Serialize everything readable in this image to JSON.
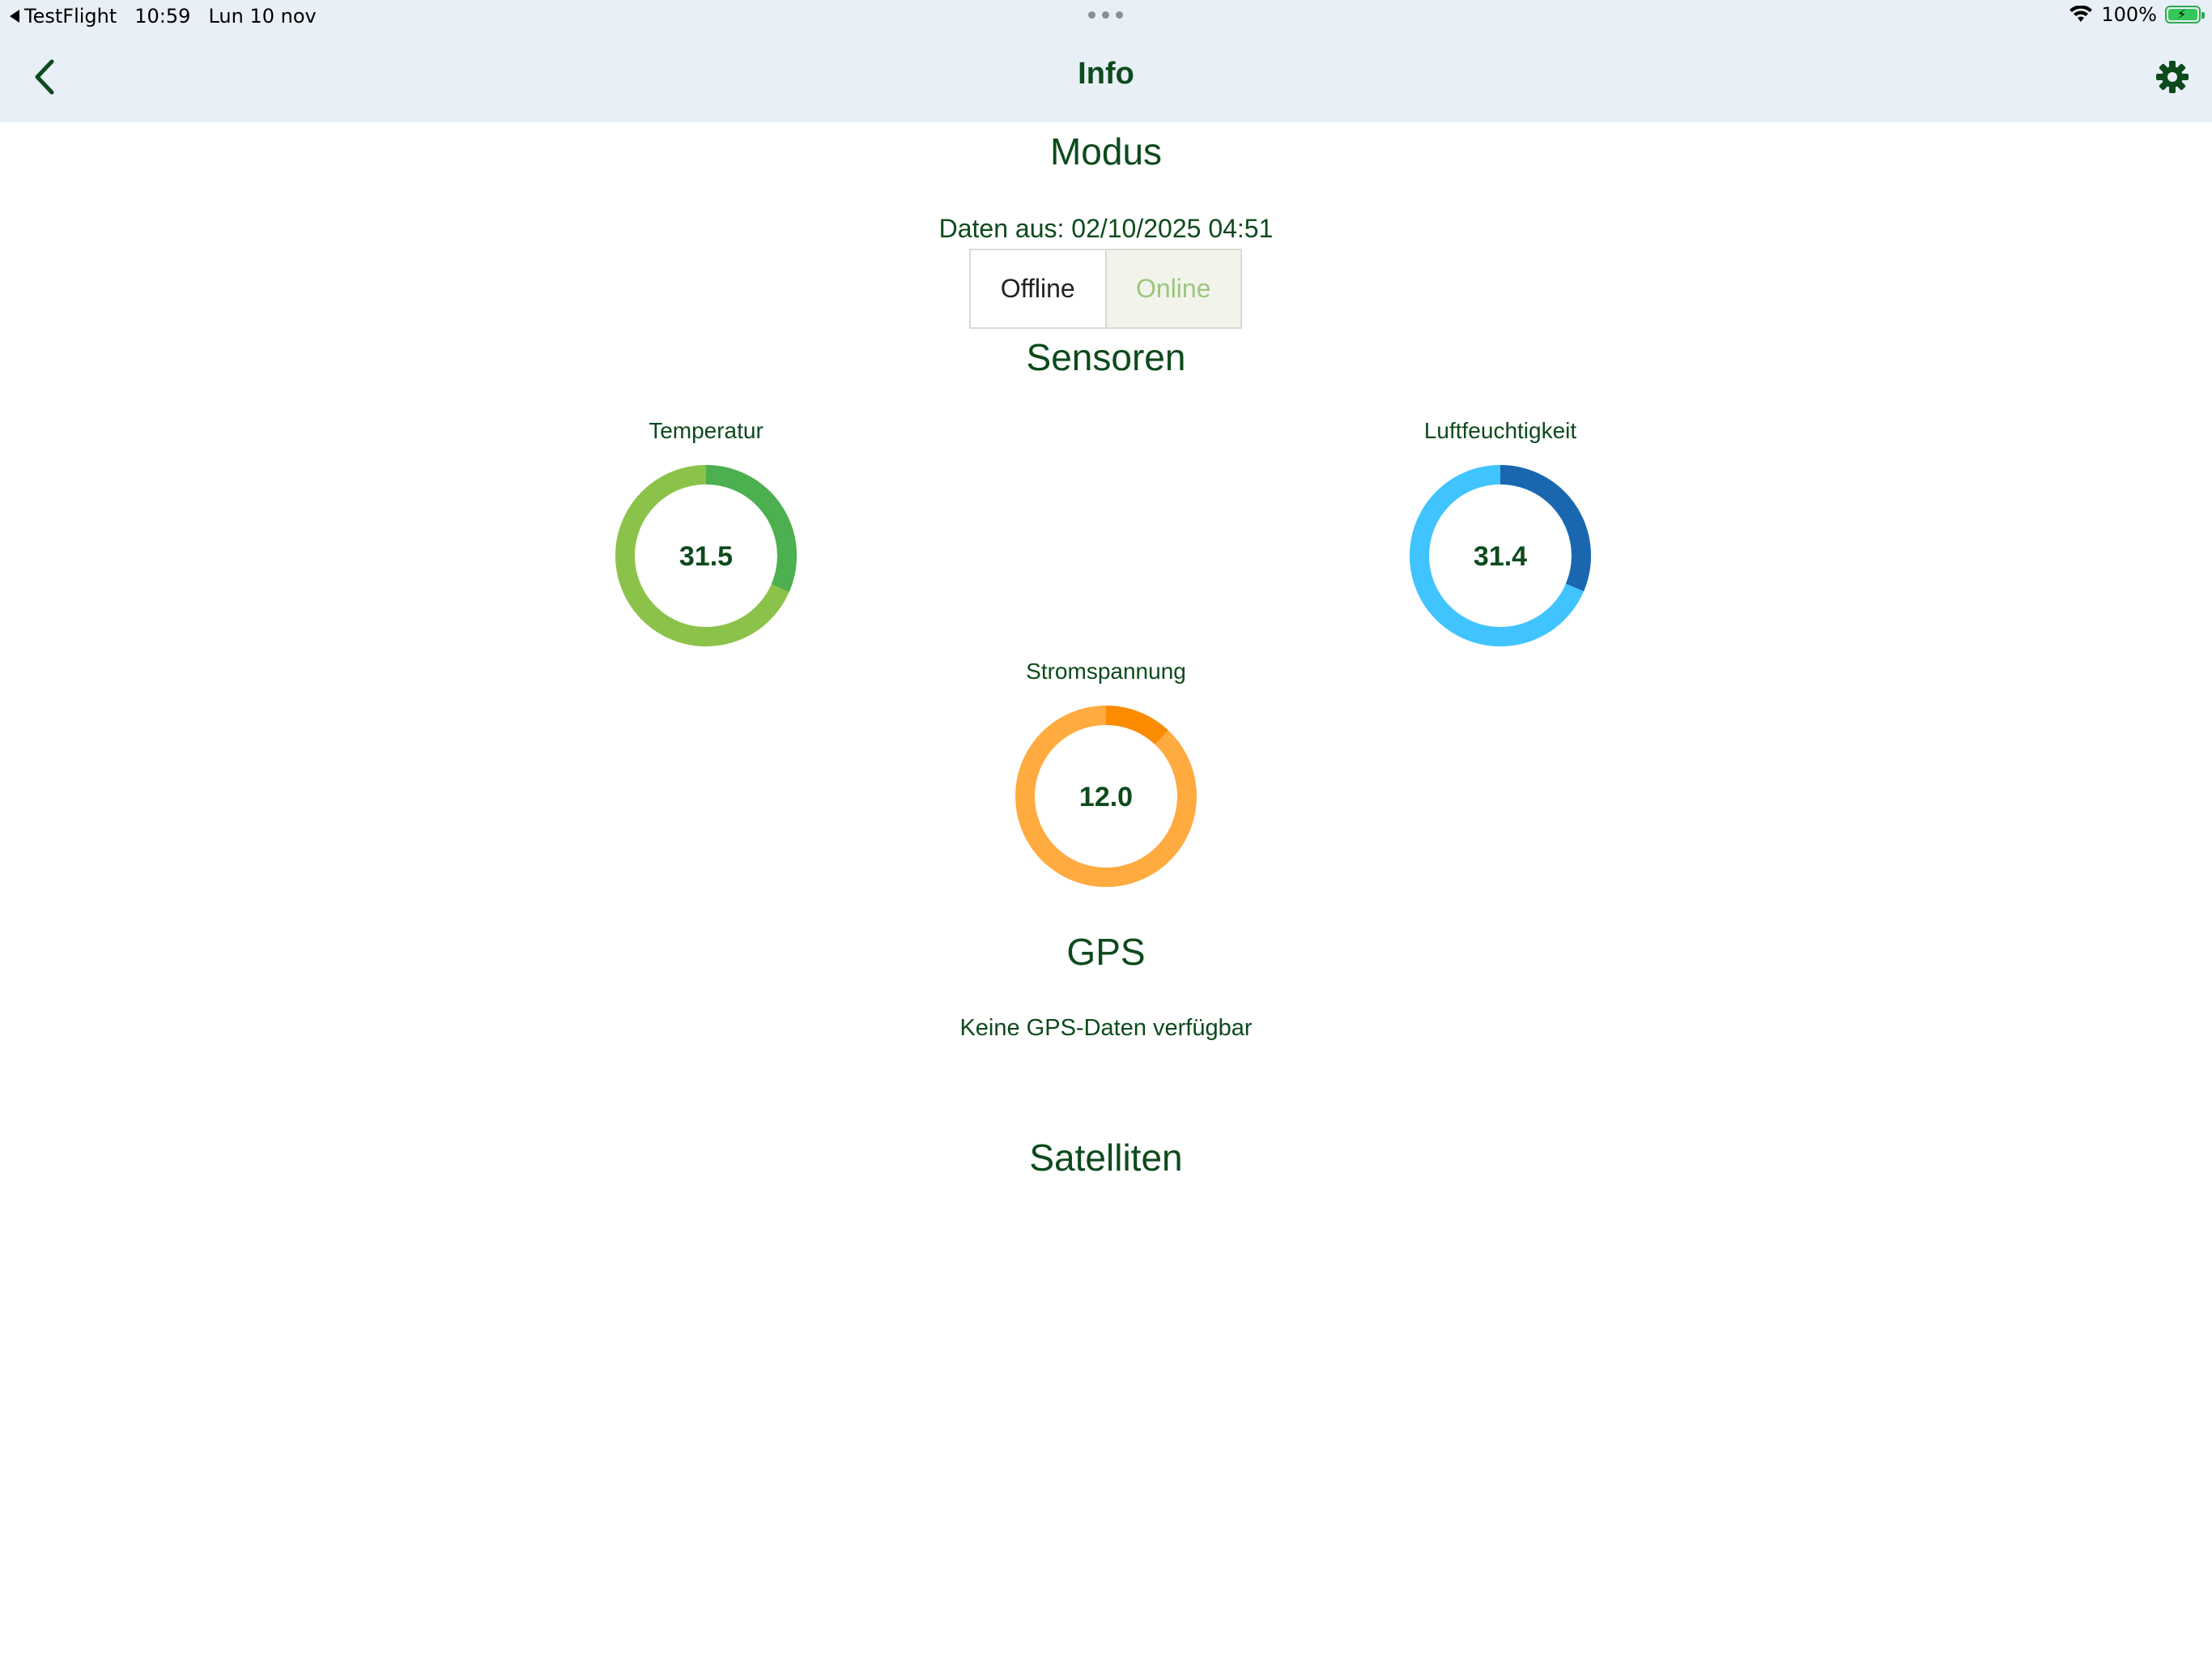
{
  "status_bar": {
    "back_app": "TestFlight",
    "time": "10:59",
    "date": "Lun 10 nov",
    "battery_percent": "100%"
  },
  "nav": {
    "title": "Info",
    "back_icon": "chevron-left-icon",
    "settings_icon": "gear-icon"
  },
  "modus": {
    "title": "Modus",
    "data_from": "Daten aus: 02/10/2025 04:51",
    "options": [
      "Offline",
      "Online"
    ],
    "selected": "Offline"
  },
  "sensoren": {
    "title": "Sensoren",
    "gauges": [
      {
        "label": "Temperatur",
        "value": "31.5",
        "fraction": 0.315,
        "color": "#8bc34a",
        "accent": "#4caf50"
      },
      {
        "label": "Luftfeuchtigkeit",
        "value": "31.4",
        "fraction": 0.314,
        "color": "#40c4ff",
        "accent": "#1a67b0"
      },
      {
        "label": "Stromspannung",
        "value": "12.0",
        "fraction": 0.12,
        "color": "#ffab40",
        "accent": "#fb8c00"
      }
    ]
  },
  "gps": {
    "title": "GPS",
    "message": "Keine GPS-Daten verfügbar"
  },
  "satelliten": {
    "title": "Satelliten"
  },
  "colors": {
    "text": "#0d4a1c",
    "nav_bg": "#e8eff6"
  }
}
